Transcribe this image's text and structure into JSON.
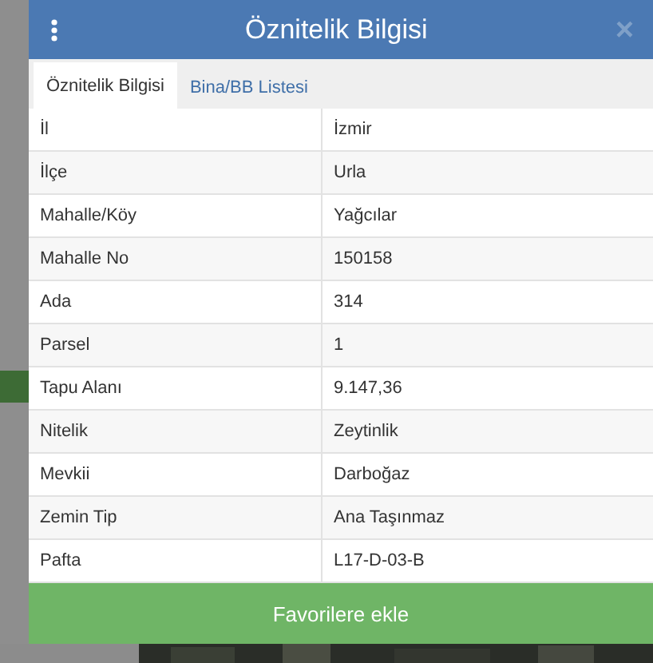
{
  "dialog": {
    "title": "Öznitelik Bilgisi",
    "close": "×"
  },
  "tabs": [
    {
      "label": "Öznitelik Bilgisi",
      "selected": true
    },
    {
      "label": "Bina/BB Listesi",
      "selected": false
    }
  ],
  "table": {
    "rows": [
      {
        "label": "İl",
        "value": "İzmir"
      },
      {
        "label": "İlçe",
        "value": "Urla"
      },
      {
        "label": "Mahalle/Köy",
        "value": "Yağcılar"
      },
      {
        "label": "Mahalle No",
        "value": "150158"
      },
      {
        "label": "Ada",
        "value": "314"
      },
      {
        "label": "Parsel",
        "value": "1"
      },
      {
        "label": "Tapu Alanı",
        "value": "9.147,36"
      },
      {
        "label": "Nitelik",
        "value": "Zeytinlik"
      },
      {
        "label": "Mevkii",
        "value": "Darboğaz"
      },
      {
        "label": "Zemin Tip",
        "value": "Ana Taşınmaz"
      },
      {
        "label": "Pafta",
        "value": "L17-D-03-B"
      }
    ]
  },
  "button": {
    "label": "Favorilere ekle"
  }
}
